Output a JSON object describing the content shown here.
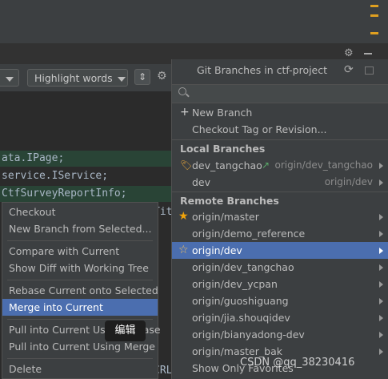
{
  "toolbar": {
    "highlight_words_label": "Highlight words"
  },
  "code": {
    "lines": [
      {
        "text": "ata.IPage;",
        "color": "#6a8759"
      },
      {
        "text": " service.IService;",
        "color": "#a9b7c6"
      },
      {
        "text": " CtfSurveyReportInfo;",
        "color": "#a9b7c6"
      },
      {
        "text": "Titl",
        "color": "#a9b7c6"
      },
      {
        "text": "CRL",
        "color": "#a9b7c6"
      }
    ]
  },
  "context_menu": {
    "items": [
      {
        "label": "Checkout"
      },
      {
        "label": "New Branch from Selected..."
      },
      {
        "label": "Compare with Current"
      },
      {
        "label": "Show Diff with Working Tree"
      },
      {
        "label": "Rebase Current onto Selected"
      },
      {
        "label": "Merge into Current"
      },
      {
        "label": "Pull into Current Using Rebase"
      },
      {
        "label": "Pull into Current Using Merge"
      },
      {
        "label": "Delete"
      }
    ]
  },
  "tooltip": {
    "text": "编辑"
  },
  "git_branches": {
    "title": "Git Branches in ctf-project",
    "search_placeholder": "",
    "actions": [
      {
        "label": "New Branch",
        "prefix": "+"
      },
      {
        "label": "Checkout Tag or Revision..."
      }
    ],
    "local_header": "Local Branches",
    "local": [
      {
        "name": "dev_tangchao",
        "tracking": "origin/dev_tangchao",
        "current": true
      },
      {
        "name": "dev",
        "tracking": "origin/dev"
      }
    ],
    "remote_header": "Remote Branches",
    "remote": [
      {
        "name": "origin/master",
        "favorite": true
      },
      {
        "name": "origin/demo_reference"
      },
      {
        "name": "origin/dev",
        "favorite_outline": true,
        "selected": true
      },
      {
        "name": "origin/dev_tangchao"
      },
      {
        "name": "origin/dev_ycpan"
      },
      {
        "name": "origin/guoshiguang"
      },
      {
        "name": "origin/jia.shouqidev"
      },
      {
        "name": "origin/bianyadong-dev"
      },
      {
        "name": "origin/master_bak"
      }
    ],
    "footer": "Show Only Favorites"
  },
  "watermark": "CSDN @qq_38230416",
  "colors": {
    "accent": "#4b6eaf",
    "star": "#f0a30a",
    "arrow_green": "#59a869"
  }
}
